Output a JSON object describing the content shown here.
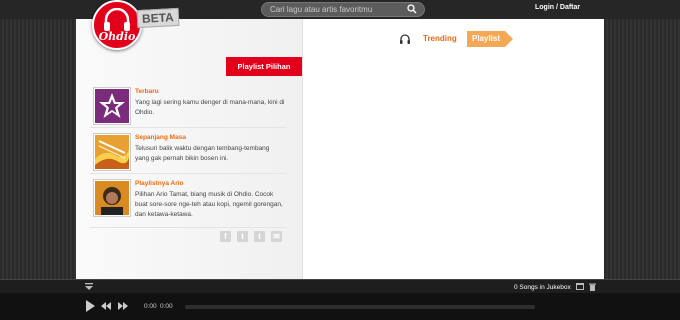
{
  "header": {
    "logo_text": "Ohdio",
    "beta_label": "BETA",
    "search_placeholder": "Cari lagu atau artis favoritmu",
    "login_label": "Login / Daftar"
  },
  "tabs": {
    "trending_label": "Trending",
    "playlist_label": "Playlist",
    "active": "Playlist"
  },
  "playlists": {
    "header_label": "Playlist Pilihan",
    "items": [
      {
        "title": "Terbaru",
        "description": "Yang lagi sering kamu denger di mana-mana, kini di Ohdio.",
        "thumb_icon": "star-icon",
        "thumb_color": "#7a2b7a"
      },
      {
        "title": "Sepanjang Masa",
        "description": "Telusuri balik waktu dengan tembang-tembang yang gak pernah bikin bosen ini.",
        "thumb_icon": "retro-icon",
        "thumb_color": "#e8a030"
      },
      {
        "title": "Playlistnya Ario",
        "description": "Pilihan Ario Tamat, biang musik di Ohdio. Cocok buat sore-sore nge-teh atau kopi, ngemil gorengan, dan ketawa-ketawa.",
        "thumb_icon": "portrait-icon",
        "thumb_color": "#c8791a"
      }
    ]
  },
  "social": [
    "f",
    "t",
    "t",
    "✉"
  ],
  "player": {
    "jukebox_text": "0 Songs in Jukebox",
    "time_current": "0:00",
    "time_total": "0:00",
    "progress": 0
  }
}
